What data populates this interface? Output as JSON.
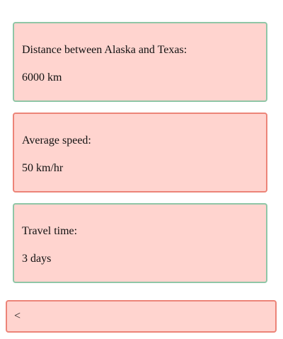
{
  "cards": [
    {
      "label": "Distance between Alaska and Texas:",
      "value": "6000 km",
      "border_color": "#8fc6a6"
    },
    {
      "label": "Average speed:",
      "value": "50 km/hr",
      "border_color": "#ec8478"
    },
    {
      "label": "Travel time:",
      "value": "3 days",
      "border_color": "#8fc6a6"
    }
  ],
  "nav": {
    "back_label": "<"
  },
  "colors": {
    "card_fill": "#ffd4cf",
    "green_border": "#8fc6a6",
    "red_border": "#ec8478"
  }
}
